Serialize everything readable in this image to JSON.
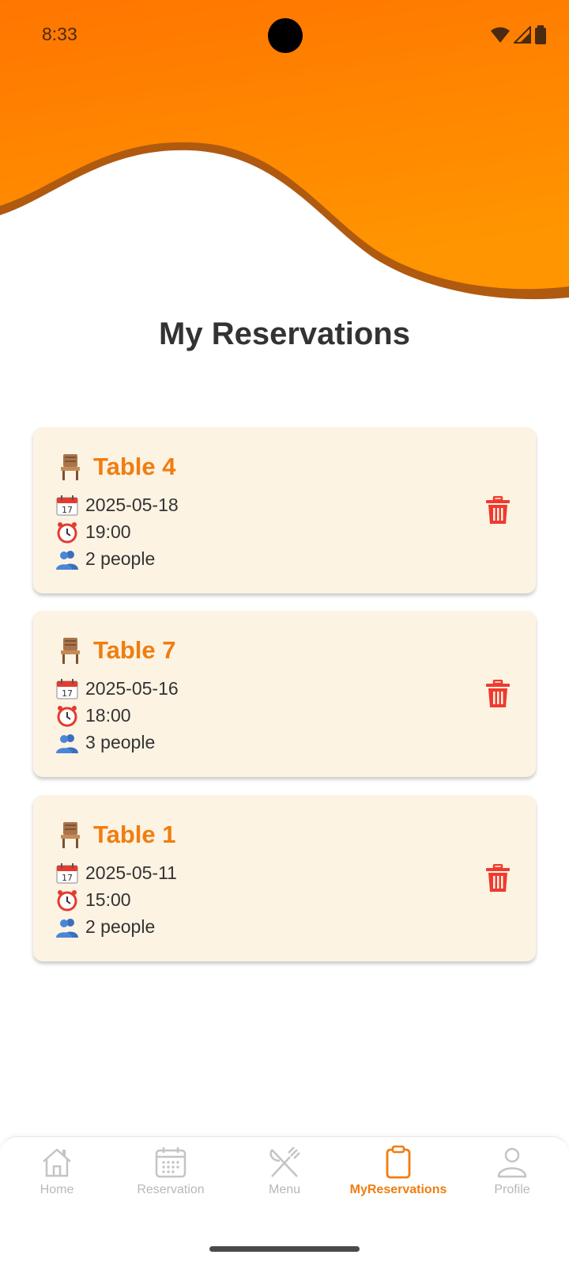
{
  "status_bar": {
    "time": "8:33",
    "icons": [
      "wifi-icon",
      "signal-icon",
      "battery-icon"
    ]
  },
  "colors": {
    "header_top": "#ff7a00",
    "header_bottom": "#ff9500",
    "accent": "#f07d10",
    "card_bg": "#fdf3e3",
    "delete": "#f03a2e",
    "nav_inactive": "#b8b8b8"
  },
  "page": {
    "title": "My Reservations"
  },
  "reservations": [
    {
      "table": "Table 4",
      "date": "2025-05-18",
      "time": "19:00",
      "people": "2 people"
    },
    {
      "table": "Table 7",
      "date": "2025-05-16",
      "time": "18:00",
      "people": "3 people"
    },
    {
      "table": "Table 1",
      "date": "2025-05-11",
      "time": "15:00",
      "people": "2 people"
    }
  ],
  "bottom_nav": {
    "active": "MyReservations",
    "items": [
      {
        "label": "Home",
        "icon": "home-icon"
      },
      {
        "label": "Reservation",
        "icon": "calendar-icon"
      },
      {
        "label": "Menu",
        "icon": "fork-knife-icon"
      },
      {
        "label": "MyReservations",
        "icon": "clipboard-icon"
      },
      {
        "label": "Profile",
        "icon": "person-icon"
      }
    ]
  }
}
